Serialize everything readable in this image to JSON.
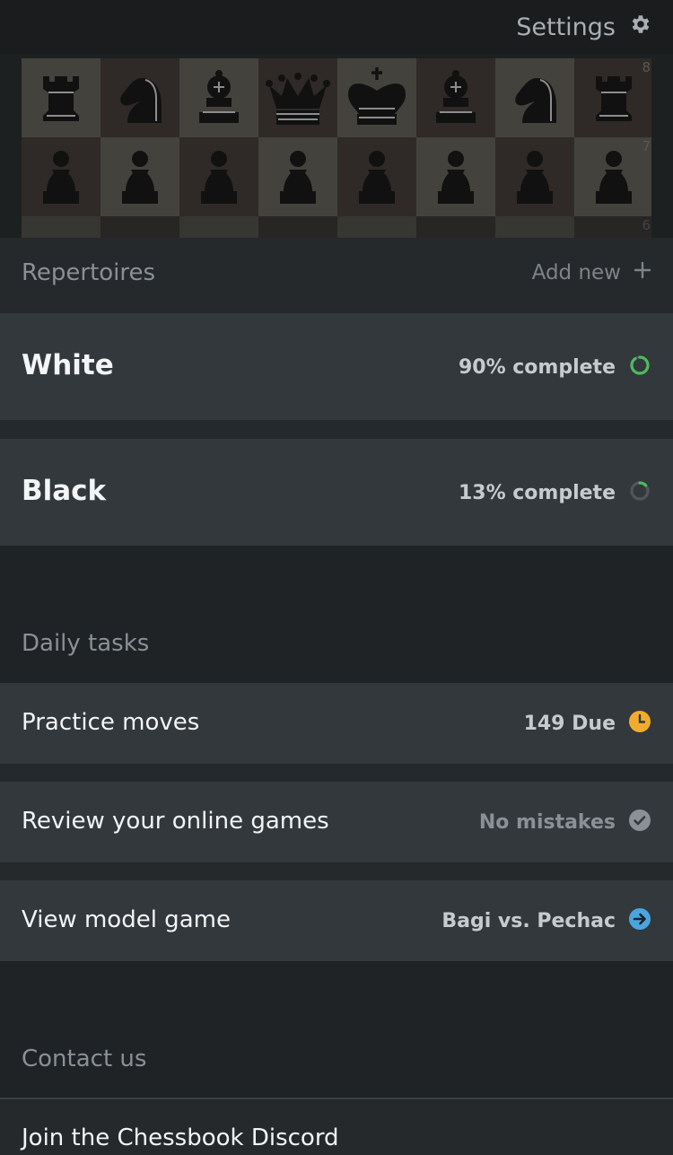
{
  "header": {
    "settings_label": "Settings",
    "settings_icon": "gear-icon"
  },
  "board": {
    "rank_labels": [
      "8",
      "7",
      "6"
    ],
    "rank8": [
      "rook",
      "knight",
      "bishop",
      "queen",
      "king",
      "bishop",
      "knight",
      "rook"
    ],
    "rank7": [
      "pawn",
      "pawn",
      "pawn",
      "pawn",
      "pawn",
      "pawn",
      "pawn",
      "pawn"
    ]
  },
  "repertoires": {
    "title": "Repertoires",
    "add_new_label": "Add new",
    "items": [
      {
        "name": "White",
        "status": "90% complete",
        "progress": 0.9,
        "color": "#4cbb5a"
      },
      {
        "name": "Black",
        "status": "13% complete",
        "progress": 0.13,
        "color": "#4cbb5a"
      }
    ]
  },
  "daily_tasks": {
    "title": "Daily tasks",
    "items": [
      {
        "label": "Practice moves",
        "status": "149 Due",
        "icon": "clock-icon",
        "color": "#f0ad2d"
      },
      {
        "label": "Review your online games",
        "status": "No mistakes",
        "icon": "check-circle-icon",
        "color": "#8a9096"
      },
      {
        "label": "View model game",
        "status": "Bagi vs. Pechac",
        "icon": "arrow-right-circle-icon",
        "color": "#49a5e0"
      }
    ]
  },
  "contact": {
    "title": "Contact us",
    "items": [
      {
        "label": "Join the Chessbook Discord"
      }
    ]
  }
}
